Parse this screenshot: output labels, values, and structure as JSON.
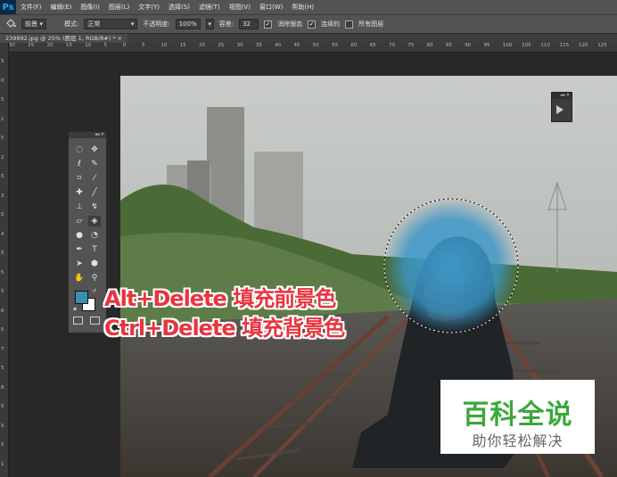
{
  "app": {
    "logo": "Ps"
  },
  "menu": [
    "文件(F)",
    "编辑(E)",
    "图像(I)",
    "图层(L)",
    "文字(Y)",
    "选择(S)",
    "滤镜(T)",
    "视图(V)",
    "窗口(W)",
    "帮助(H)"
  ],
  "options": {
    "fill_source": "前景",
    "mode_label": "模式:",
    "mode_value": "正常",
    "opacity_label": "不透明度:",
    "opacity_value": "100%",
    "tolerance_label": "容差:",
    "tolerance_value": "32",
    "antialias_label": "消除锯齿",
    "contiguous_label": "连续的",
    "all_layers_label": "所有图层"
  },
  "document_tab": "239992.jpg @ 25% (图层 1, RGB/8#) * ×",
  "ruler_top": [
    "30",
    "25",
    "20",
    "15",
    "10",
    "5",
    "0",
    "5",
    "10",
    "15",
    "20",
    "25",
    "30",
    "35",
    "40",
    "45",
    "50",
    "55",
    "60",
    "65",
    "70",
    "75",
    "80",
    "85",
    "90",
    "95",
    "100",
    "105",
    "110",
    "115",
    "120",
    "125"
  ],
  "ruler_left": [
    "5",
    "0",
    "5",
    "1",
    "5",
    "2",
    "5",
    "3",
    "5",
    "4",
    "5",
    "5",
    "5",
    "6",
    "5",
    "7",
    "5",
    "8",
    "5",
    "9",
    "5",
    "1"
  ],
  "annotations": {
    "line1": "Alt+Delete 填充前景色",
    "line2": "Ctrl+Delete 填充背景色"
  },
  "watermark": {
    "title": "百科全说",
    "subtitle": "助你轻松解决"
  },
  "colors": {
    "foreground": "#3a8fb0",
    "background": "#ffffff",
    "accent_red": "#e8343f",
    "brand_green": "#3aa83a"
  },
  "tools": [
    "marquee-icon",
    "move-icon",
    "lasso-icon",
    "quick-select-icon",
    "crop-icon",
    "eyedropper-icon",
    "healing-icon",
    "brush-icon",
    "stamp-icon",
    "history-brush-icon",
    "eraser-icon",
    "paint-bucket-icon",
    "blur-icon",
    "dodge-icon",
    "pen-icon",
    "type-icon",
    "path-select-icon",
    "shape-icon",
    "hand-icon",
    "zoom-icon"
  ]
}
